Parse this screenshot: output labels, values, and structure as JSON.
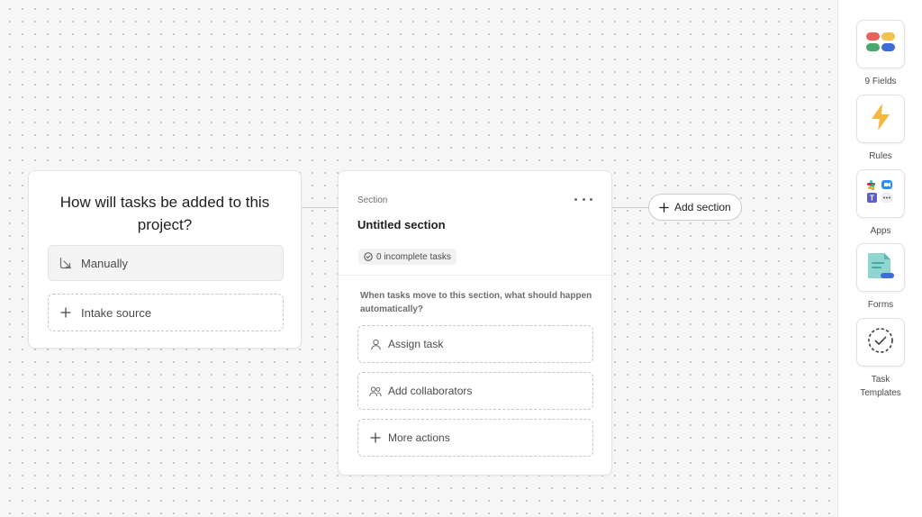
{
  "intake": {
    "title": "How will tasks be added to this project?",
    "options": [
      {
        "label": "Manually",
        "icon": "arrow-down-right-icon"
      },
      {
        "label": "Intake source",
        "icon": "plus-icon"
      }
    ]
  },
  "section": {
    "eyebrow": "Section",
    "name": "Untitled section",
    "badge": "0 incomplete tasks",
    "automation_prompt": "When tasks move to this section, what should happen automatically?",
    "actions": [
      {
        "label": "Assign task",
        "icon": "person-icon"
      },
      {
        "label": "Add collaborators",
        "icon": "people-icon"
      },
      {
        "label": "More actions",
        "icon": "plus-icon"
      }
    ]
  },
  "add_section": {
    "label": "Add section"
  },
  "sidebar": {
    "items": [
      {
        "label": "9 Fields",
        "icon": "fields-icon"
      },
      {
        "label": "Rules",
        "icon": "lightning-icon"
      },
      {
        "label": "Apps",
        "icon": "apps-icon"
      },
      {
        "label": "Forms",
        "icon": "form-icon"
      },
      {
        "label": "Task Templates",
        "icon": "checkmark-circle-icon"
      }
    ]
  },
  "colors": {
    "canvas_bg": "#f7f6f6",
    "dot": "#c9c7c7",
    "text_primary": "#1e1f21",
    "text_secondary": "#6d6e6f",
    "lightning": "#f5b73b",
    "field_red": "#e8615a",
    "field_yellow": "#f2c14e",
    "field_green": "#4ba96e",
    "field_blue": "#3f6cd8"
  }
}
